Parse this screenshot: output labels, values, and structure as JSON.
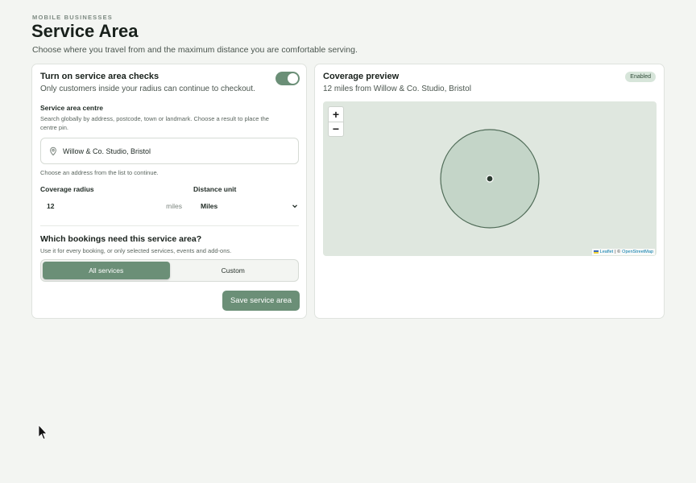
{
  "header": {
    "eyebrow": "MOBILE BUSINESSES",
    "title": "Service Area",
    "subtitle": "Choose where you travel from and the maximum distance you are comfortable serving."
  },
  "settings": {
    "toggle_title": "Turn on service area checks",
    "toggle_desc": "Only customers inside your radius can continue to checkout.",
    "toggle_on": true,
    "centre_label": "Service area centre",
    "centre_help": "Search globally by address, postcode, town or landmark. Choose a result to place the centre pin.",
    "address_value": "Willow & Co. Studio, Bristol",
    "address_help": "Choose an address from the list to continue.",
    "radius_label": "Coverage radius",
    "radius_value": "12",
    "radius_unit": "miles",
    "unit_label": "Distance unit",
    "unit_value": "Miles",
    "bookings_title": "Which bookings need this service area?",
    "bookings_help": "Use it for every booking, or only selected services, events and add-ons.",
    "segment_all": "All services",
    "segment_custom": "Custom",
    "save_label": "Save service area"
  },
  "preview": {
    "title": "Coverage preview",
    "badge": "Enabled",
    "subtitle": "12 miles from Willow & Co. Studio, Bristol",
    "zoom_in": "+",
    "zoom_out": "−",
    "attr_leaflet": "Leaflet",
    "attr_sep": "| ©",
    "attr_osm": "OpenStreetMap",
    "accent_color": "#6b8f77"
  }
}
